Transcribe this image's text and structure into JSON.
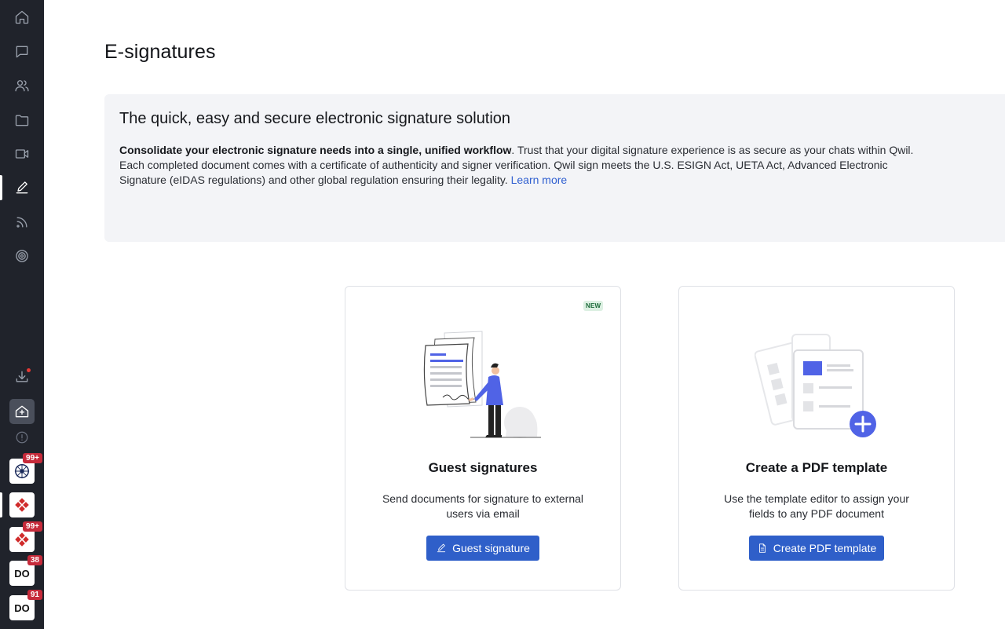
{
  "page": {
    "title": "E-signatures"
  },
  "sidebar": {
    "nav": [
      {
        "icon": "home-icon"
      },
      {
        "icon": "chat-icon"
      },
      {
        "icon": "contacts-icon"
      },
      {
        "icon": "folder-icon"
      },
      {
        "icon": "video-icon"
      },
      {
        "icon": "pen-icon",
        "active": true
      },
      {
        "icon": "feed-icon"
      },
      {
        "icon": "target-icon"
      }
    ],
    "orgs": [
      {
        "icon": "compass-logo",
        "badge": "99+"
      },
      {
        "icon": "diamond-logo",
        "badge": ""
      },
      {
        "icon": "diamond-logo",
        "badge": "99+"
      },
      {
        "label": "DO",
        "badge": "38"
      },
      {
        "label": "DO",
        "badge": "91"
      }
    ]
  },
  "banner": {
    "title": "The quick, easy and secure electronic signature solution",
    "bold_text": "Consolidate your electronic signature needs into a single, unified workflow",
    "body_text": ". Trust that your digital signature experience is as secure as your chats within Qwil. Each completed document comes with a certificate of authenticity and signer verification. Qwil sign meets the U.S. ESIGN Act, UETA Act, Advanced Electronic Signature (eIDAS regulations) and other global regulation ensuring their legality. ",
    "link_text": "Learn more"
  },
  "cards": {
    "guest": {
      "badge": "NEW",
      "title": "Guest signatures",
      "description": "Send documents for signature to external users via email",
      "button_label": "Guest signature"
    },
    "template": {
      "title": "Create a PDF template",
      "description": "Use the template editor to assign your fields to any PDF document",
      "button_label": "Create PDF template"
    }
  },
  "colors": {
    "sidebar": "#20232b",
    "accent": "#2f5fc9",
    "banner_bg": "#f3f4f7",
    "badge_red": "#c62a3a"
  }
}
